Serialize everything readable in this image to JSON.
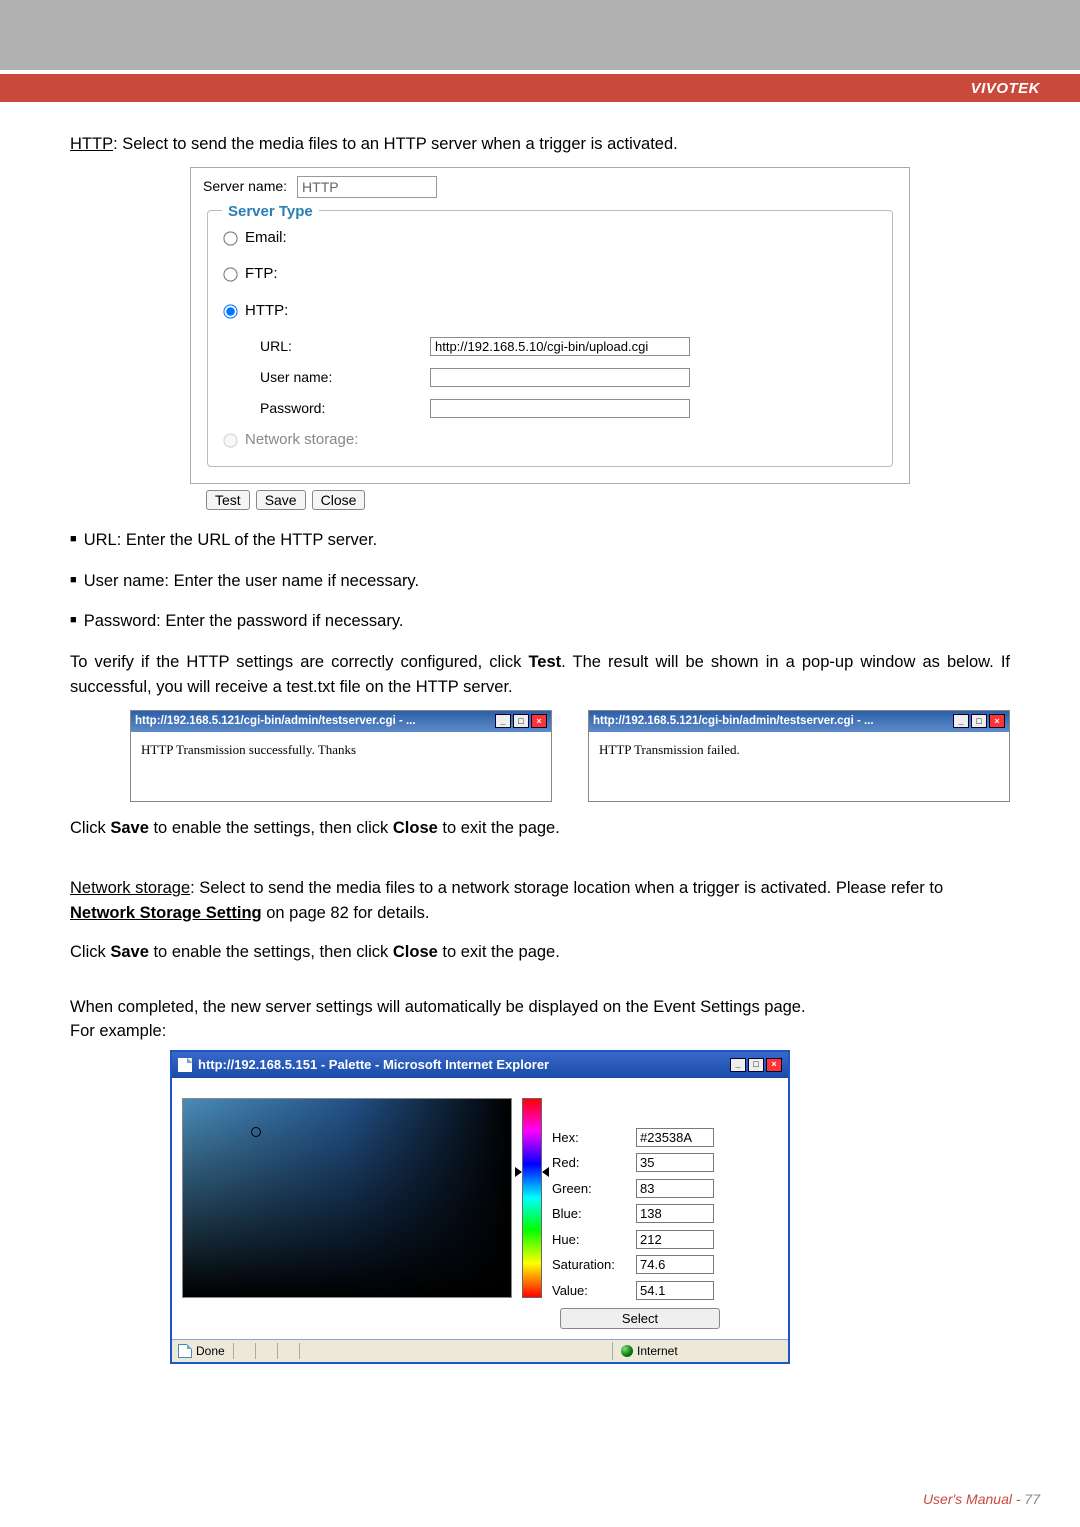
{
  "brand": "VIVOTEK",
  "intro": {
    "key": "HTTP",
    "text": ": Select to send the media files to an HTTP server when a trigger is activated."
  },
  "form": {
    "server_name_label": "Server name:",
    "server_name_value": "HTTP",
    "fieldset_title": "Server Type",
    "radios": {
      "email": "Email:",
      "ftp": "FTP:",
      "http": "HTTP:",
      "ns": "Network storage:"
    },
    "fields": {
      "url_label": "URL:",
      "url_value": "http://192.168.5.10/cgi-bin/upload.cgi",
      "user_label": "User name:",
      "pass_label": "Password:"
    },
    "buttons": {
      "test": "Test",
      "save": "Save",
      "close": "Close"
    }
  },
  "bullets": {
    "url": "URL: Enter the URL of the HTTP server.",
    "user": "User name: Enter the user name if necessary.",
    "pass": "Password: Enter the password if necessary."
  },
  "verify": {
    "p1a": "To verify if the HTTP settings are correctly configured, click ",
    "p1b": "Test",
    "p1c": ". The result will be shown in a pop-up window as below. If successful, you will receive a test.txt file on the HTTP server."
  },
  "popup": {
    "title": "http://192.168.5.121/cgi-bin/admin/testserver.cgi - ...",
    "success": "HTTP Transmission successfully. Thanks",
    "fail": "HTTP Transmission failed."
  },
  "after_popup": {
    "a": "Click ",
    "b": "Save",
    "c": " to enable the settings, then click ",
    "d": "Close",
    "e": " to exit the page."
  },
  "ns": {
    "key": "Network storage",
    "text": ": Select to send the media files to a network storage location when a trigger is activated. Please refer to ",
    "link": "Network Storage Setting",
    "tail": " on page 82 for details."
  },
  "ns2": {
    "a": "Click ",
    "b": "Save",
    "c": " to enable the settings, then click ",
    "d": "Close",
    "e": " to exit the page."
  },
  "completed": {
    "line1": "When completed, the new server settings will automatically be displayed on the Event Settings page.",
    "line2": "For example:"
  },
  "ie": {
    "title": "http://192.168.5.151 - Palette - Microsoft Internet Explorer",
    "labels": {
      "hex": "Hex:",
      "red": "Red:",
      "green": "Green:",
      "blue": "Blue:",
      "hue": "Hue:",
      "sat": "Saturation:",
      "val": "Value:"
    },
    "values": {
      "hex": "#23538A",
      "red": "35",
      "green": "83",
      "blue": "138",
      "hue": "212",
      "sat": "74.6",
      "val": "54.1"
    },
    "select": "Select",
    "status_done": "Done",
    "status_zone": "Internet"
  },
  "footer": {
    "um": "User's Manual - ",
    "page": "77"
  },
  "winbtns": {
    "min": "_",
    "max": "□",
    "close": "×"
  }
}
